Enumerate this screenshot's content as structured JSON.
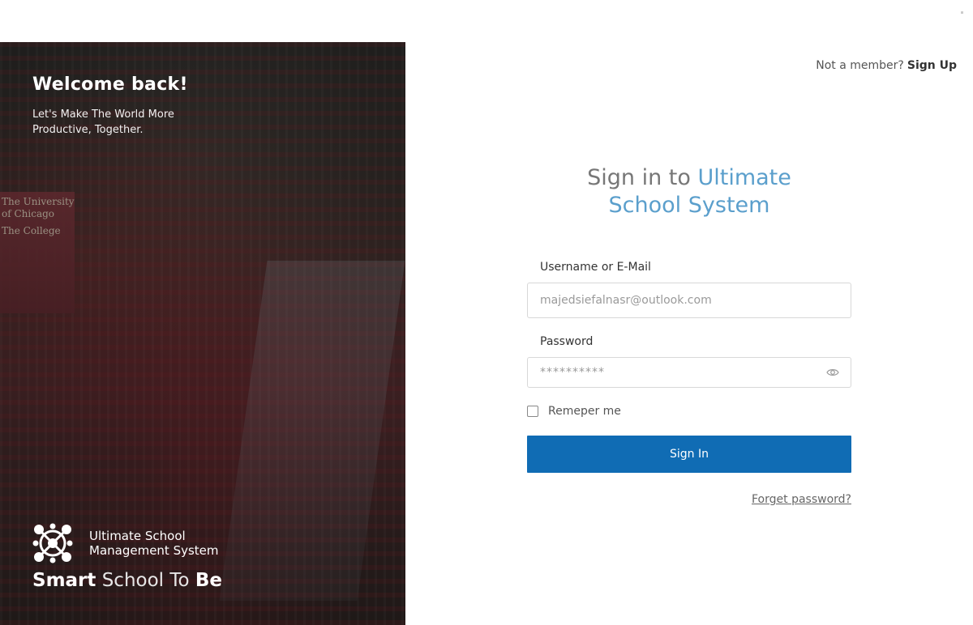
{
  "hero": {
    "title": "Welcome back!",
    "subtitle": "Let's Make The World More Productive, Together.",
    "banner_lines": [
      "The University",
      "of Chicago",
      "",
      "The College"
    ],
    "logo_line1": "Ultimate School",
    "logo_line2": "Management System",
    "tagline": {
      "w1": "Smart",
      "w2": "School",
      "w3": "To",
      "w4": "Be"
    }
  },
  "header": {
    "member_text": "Not a member?",
    "signup_label": "Sign Up"
  },
  "form": {
    "heading_prefix": "Sign in to",
    "heading_accent_line1": "Ultimate",
    "heading_accent_line2": "School System",
    "username_label": "Username or E-Mail",
    "username_placeholder": "majedsiefalnasr@outlook.com",
    "password_label": "Password",
    "password_value": "**********",
    "remember_label": "Remeper me",
    "signin_label": "Sign In",
    "forgot_label": "Forget password?"
  },
  "colors": {
    "accent": "#5b9fcc",
    "button": "#106cb4"
  },
  "icons": {
    "password_toggle": "eye-icon",
    "logo": "network-logo-icon"
  }
}
